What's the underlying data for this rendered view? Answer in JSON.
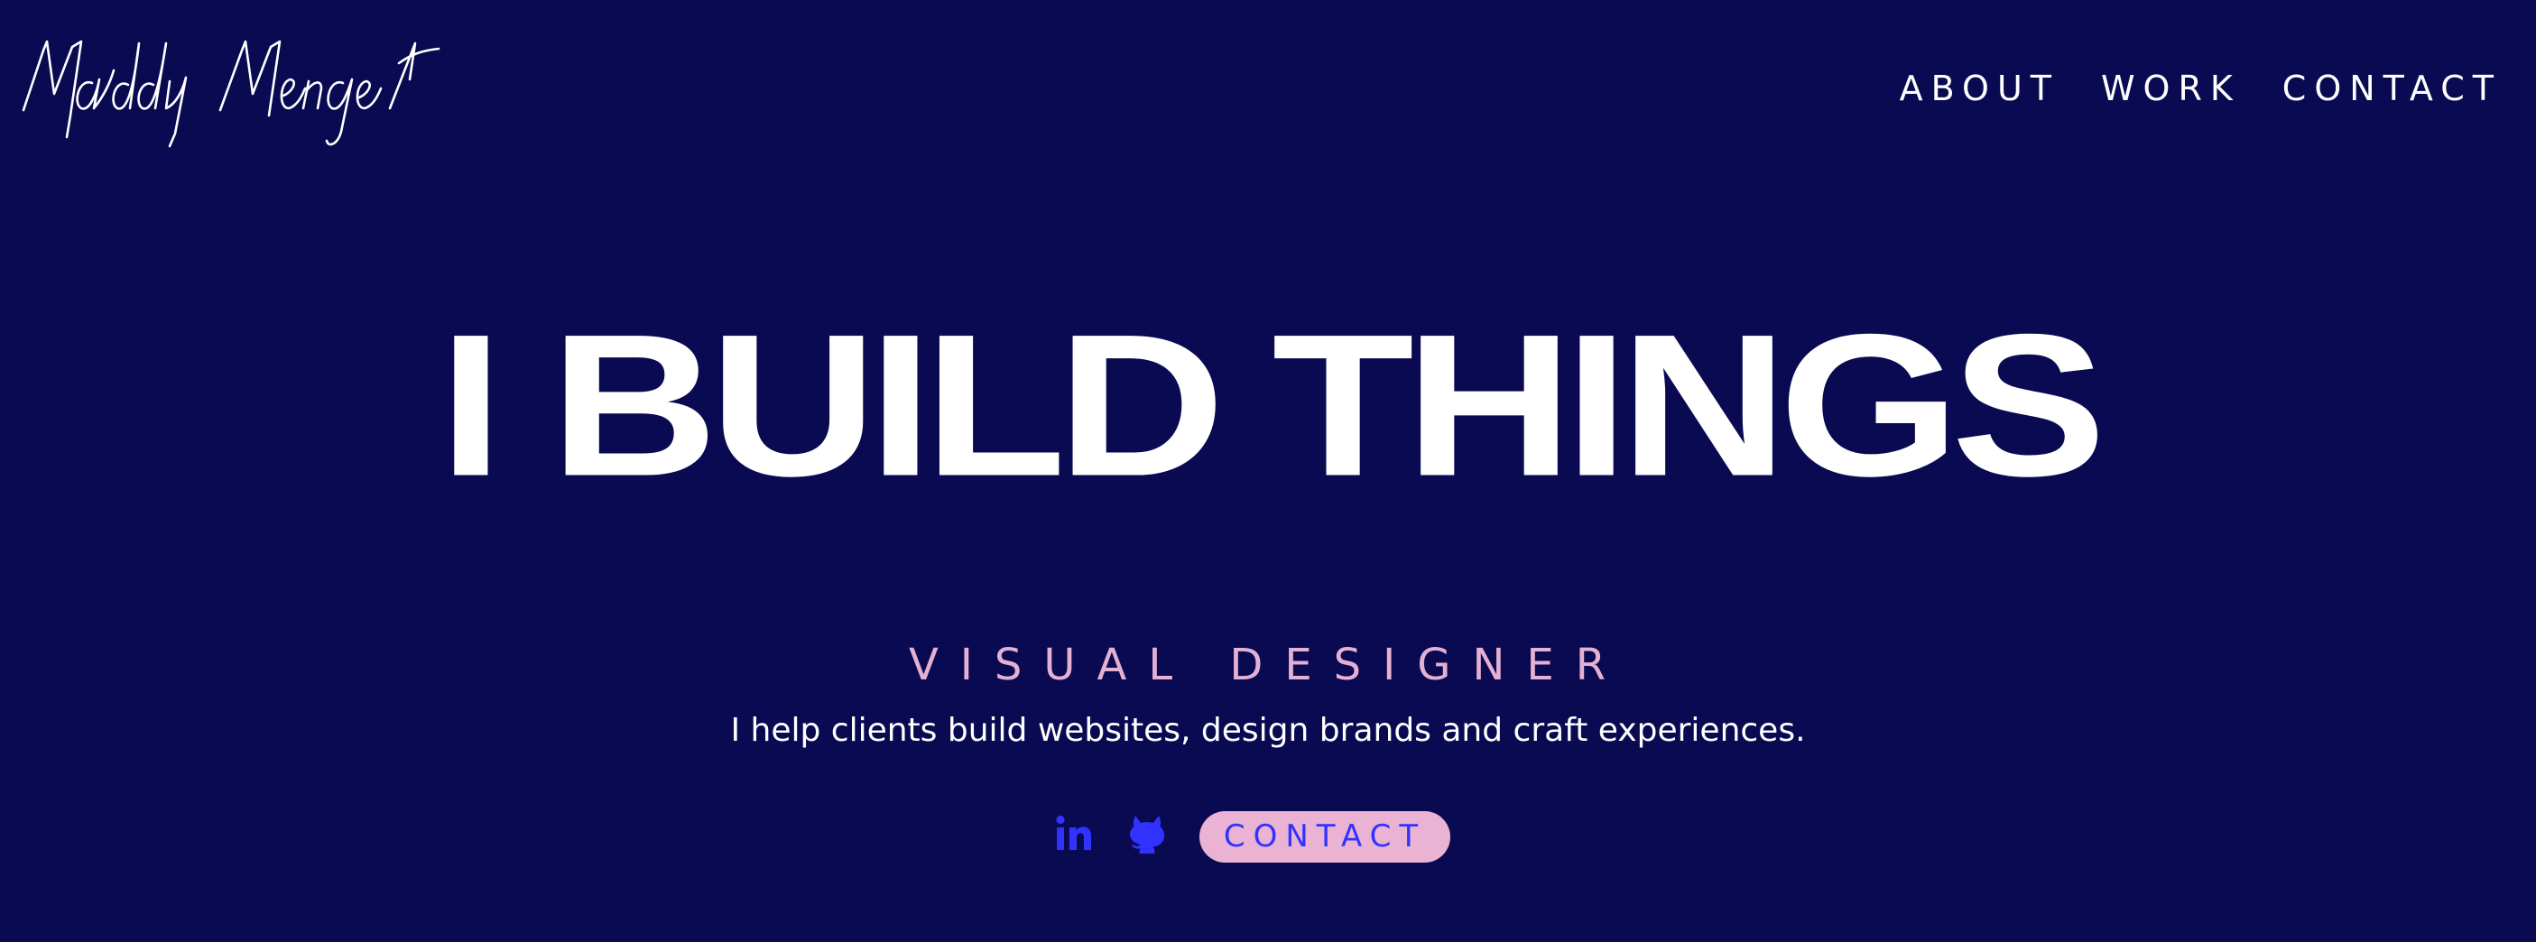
{
  "header": {
    "logo_text": "Maddy Mengel",
    "nav": [
      {
        "label": "ABOUT"
      },
      {
        "label": "WORK"
      },
      {
        "label": "CONTACT"
      }
    ]
  },
  "hero": {
    "title": "I BUILD THINGS",
    "subtitle": "VISUAL DESIGNER",
    "tagline": "I help clients build websites, design brands and craft experiences.",
    "social": [
      {
        "icon": "linkedin-icon",
        "label": "in"
      },
      {
        "icon": "github-icon"
      }
    ],
    "contact_label": "CONTACT"
  },
  "colors": {
    "background": "#0a0a52",
    "text": "#ffffff",
    "accent_pink": "#e4b1d2",
    "button_bg": "#eab3d4",
    "brand_blue": "#3232ff"
  }
}
